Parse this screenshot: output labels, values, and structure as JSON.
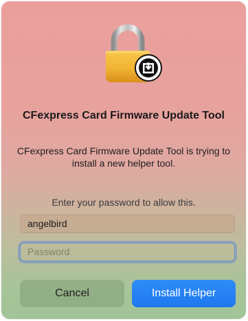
{
  "dialog": {
    "icon": "lock-with-download-badge-icon",
    "title": "CFexpress Card Firmware Update Tool",
    "message": "CFexpress Card Firmware Update Tool is trying to install a new helper tool.",
    "prompt": "Enter your password to allow this.",
    "username_value": "angelbird",
    "password_placeholder": "Password",
    "cancel_label": "Cancel",
    "confirm_label": "Install Helper"
  },
  "colors": {
    "primary_button": "#2a85f4",
    "lock_gold": "#f2b534",
    "focus_ring": "#6e8fc9"
  }
}
